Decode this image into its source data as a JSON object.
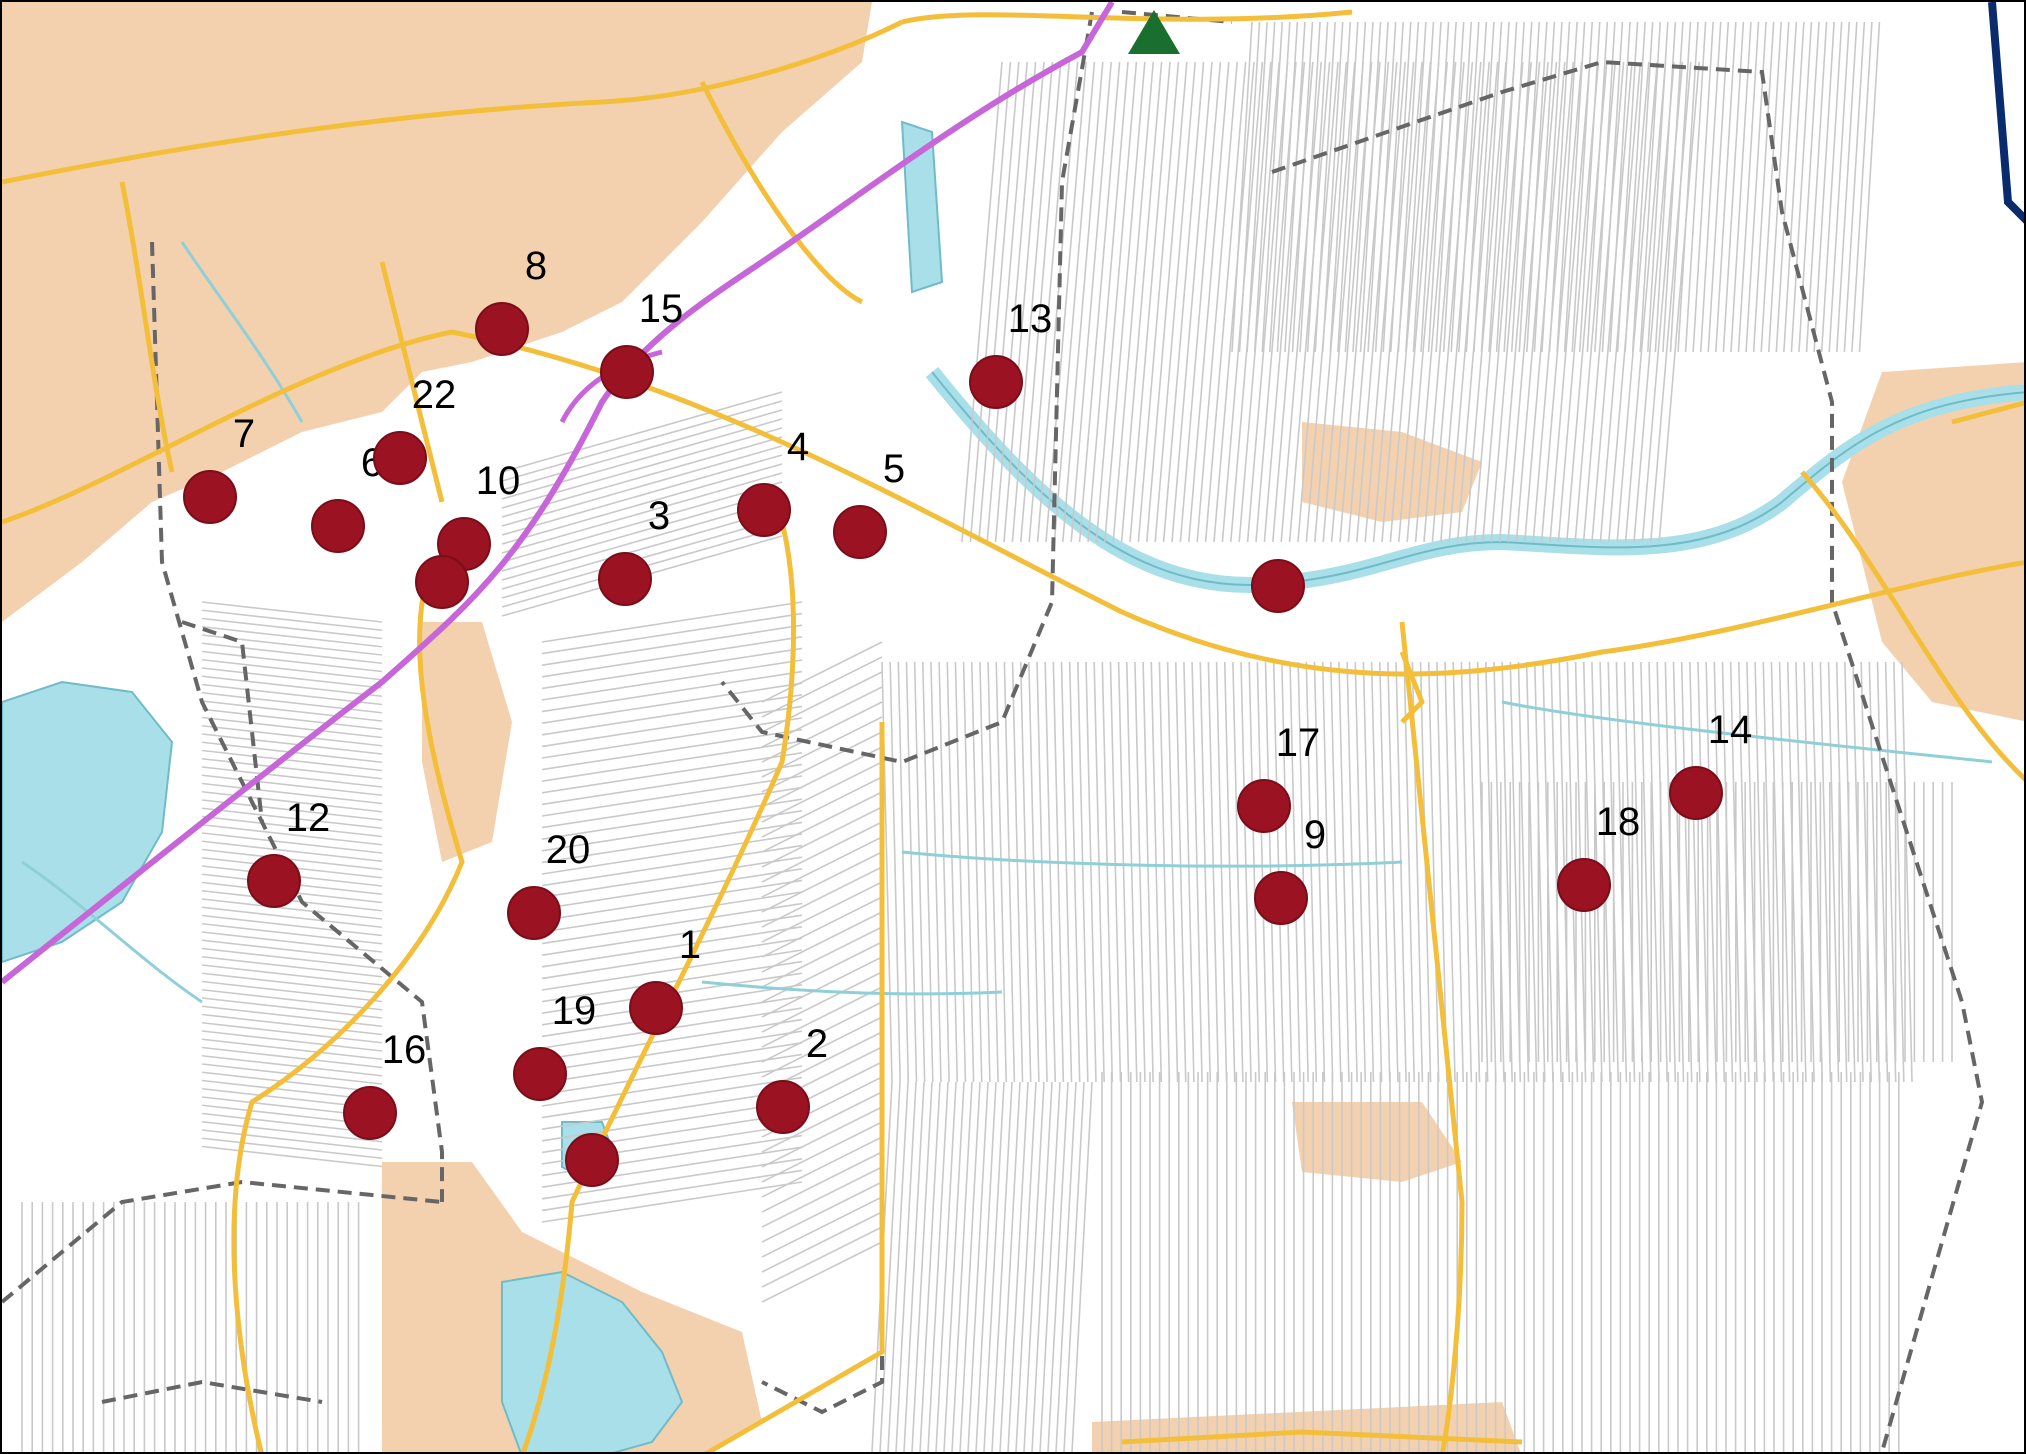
{
  "map": {
    "colors": {
      "land": "#ffffff",
      "urban": "#f2c9a0",
      "water": "#a9dfe8",
      "ditch": "#8fcfd8",
      "parcel": "#c9c9c9",
      "road_major": "#f3bf3a",
      "highway": "#c766d8",
      "boundary": "#666666",
      "marker": "#9b1222",
      "marker_stroke": "#7a0d19",
      "north_triangle": "#1a6e2e",
      "edge_line": "#0a2c6e"
    },
    "north_marker_icon": "triangle-icon",
    "markers": [
      {
        "label": "1"
      },
      {
        "label": "2"
      },
      {
        "label": "3"
      },
      {
        "label": "4"
      },
      {
        "label": "5"
      },
      {
        "label": "6"
      },
      {
        "label": "7"
      },
      {
        "label": "8"
      },
      {
        "label": "9"
      },
      {
        "label": "10"
      },
      {
        "label": "12"
      },
      {
        "label": "13"
      },
      {
        "label": "14"
      },
      {
        "label": "15"
      },
      {
        "label": "16"
      },
      {
        "label": "17"
      },
      {
        "label": "18"
      },
      {
        "label": "19"
      },
      {
        "label": "20"
      },
      {
        "label": "22"
      },
      {
        "label": ""
      },
      {
        "label": ""
      },
      {
        "label": ""
      }
    ]
  }
}
